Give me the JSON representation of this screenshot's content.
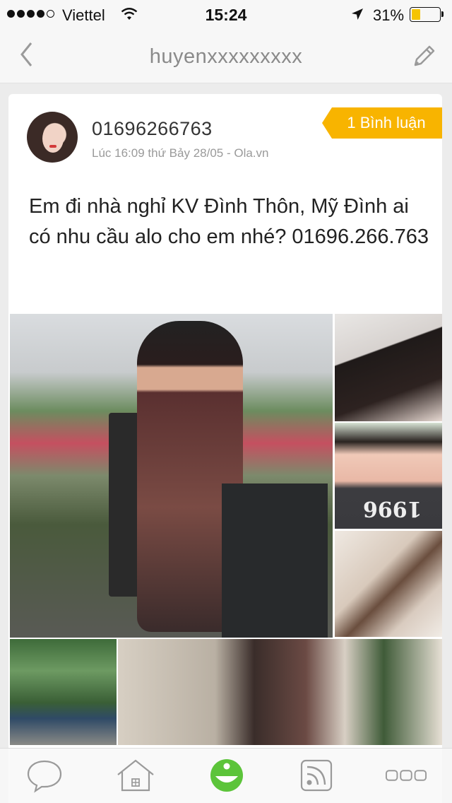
{
  "status_bar": {
    "carrier": "Viettel",
    "time": "15:24",
    "battery": "31%",
    "battery_level": 0.31
  },
  "nav": {
    "back_icon": "chevron-left-icon",
    "title": "huyenxxxxxxxxx",
    "edit_icon": "pencil-icon"
  },
  "post": {
    "author": "01696266763",
    "meta": "Lúc 16:09 thứ Bảy 28/05 - Ola.vn",
    "comment_badge": "1 Bình luận",
    "text": "Em đi nhà nghỉ KV Đình Thôn, Mỹ Đình ai có nhu cầu alo cho em nhé? 01696.266.763",
    "photo_count": 6
  },
  "tab_bar": {
    "items": [
      {
        "icon": "chat-bubble-icon",
        "active": false
      },
      {
        "icon": "home-icon",
        "active": false
      },
      {
        "icon": "smiley-icon",
        "active": true
      },
      {
        "icon": "rss-feed-icon",
        "active": false
      },
      {
        "icon": "more-icon",
        "active": false
      }
    ]
  },
  "colors": {
    "accent": "#f8b400",
    "active_tab": "#5cc43a",
    "inactive_icon": "#9a9a9a"
  }
}
